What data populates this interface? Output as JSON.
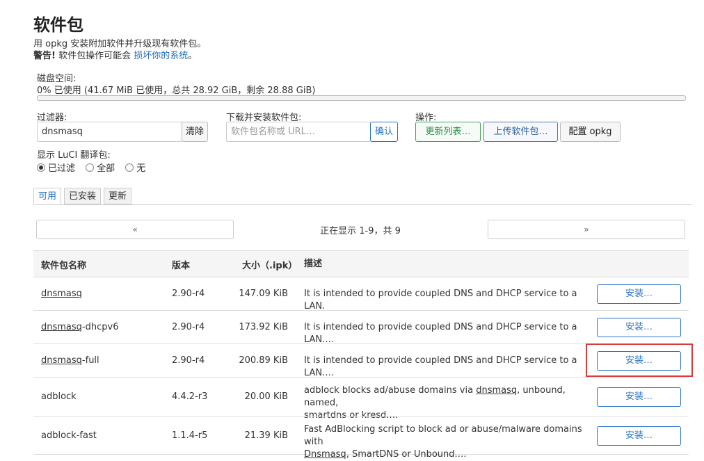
{
  "page": {
    "title": "软件包",
    "description": "用 opkg 安装附加软件并升级现有软件包。",
    "warning_bold": "警告!",
    "warning_text": " 软件包操作可能会 ",
    "warning_link": "损坏你的系统",
    "warning_end": "。"
  },
  "disk": {
    "label": "磁盘空间:",
    "usage_text": "0% 已使用 (41.67 MiB 已使用，总共 28.92 GiB，剩余 28.88 GiB)",
    "percent_used": 0
  },
  "filter": {
    "label": "过滤器:",
    "value": "dnsmasq",
    "clear_label": "清除"
  },
  "download": {
    "label": "下载并安装软件包:",
    "placeholder": "软件包名称或 URL…",
    "confirm_label": "确认"
  },
  "actions": {
    "label": "操作:",
    "update_lists": "更新列表…",
    "upload_package": "上传软件包…",
    "configure_opkg": "配置 opkg"
  },
  "luci_filter": {
    "label": "显示 LuCI 翻译包:",
    "options": [
      "已过滤",
      "全部",
      "无"
    ],
    "selected": "已过滤"
  },
  "tabs": [
    "可用",
    "已安装",
    "更新"
  ],
  "active_tab": "可用",
  "pager": {
    "prev": "«",
    "next": "»",
    "status": "正在显示 1-9，共 9"
  },
  "table": {
    "headers": [
      "软件包名称",
      "版本",
      "大小（.ipk）",
      "描述"
    ],
    "install_label": "安装…",
    "rows": [
      {
        "name_link": "dnsmasq",
        "name_rest": "",
        "version": "2.90-r4",
        "size": "147.09 KiB",
        "desc": "It is intended to provide coupled DNS and DHCP service to a LAN.",
        "desc2": ""
      },
      {
        "name_link": "dnsmasq",
        "name_rest": "-dhcpv6",
        "version": "2.90-r4",
        "size": "173.92 KiB",
        "desc": "It is intended to provide coupled DNS and DHCP service to a LAN.…",
        "desc2": ""
      },
      {
        "name_link": "dnsmasq",
        "name_rest": "-full",
        "version": "2.90-r4",
        "size": "200.89 KiB",
        "desc": "It is intended to provide coupled DNS and DHCP service to a LAN.…",
        "desc2": ""
      },
      {
        "name_link": "",
        "name_rest": "adblock",
        "version": "4.4.2-r3",
        "size": "20.00 KiB",
        "desc_a": "adblock blocks ad/abuse domains via ",
        "desc_link": "dnsmasq",
        "desc_b": ", unbound, named,",
        "desc2": "smartdns or kresd.…"
      },
      {
        "name_link": "",
        "name_rest": "adblock-fast",
        "version": "1.1.4-r5",
        "size": "21.39 KiB",
        "desc_a": "Fast AdBlocking script to block ad or abuse/malware domains with",
        "desc_link": "",
        "desc_b": "",
        "desc2_link": "Dnsmasq",
        "desc2": ", SmartDNS or Unbound.…"
      }
    ]
  },
  "colors": {
    "accent_blue": "#2a75c7",
    "green": "#3aa658",
    "highlight_red": "#d93a3a"
  }
}
